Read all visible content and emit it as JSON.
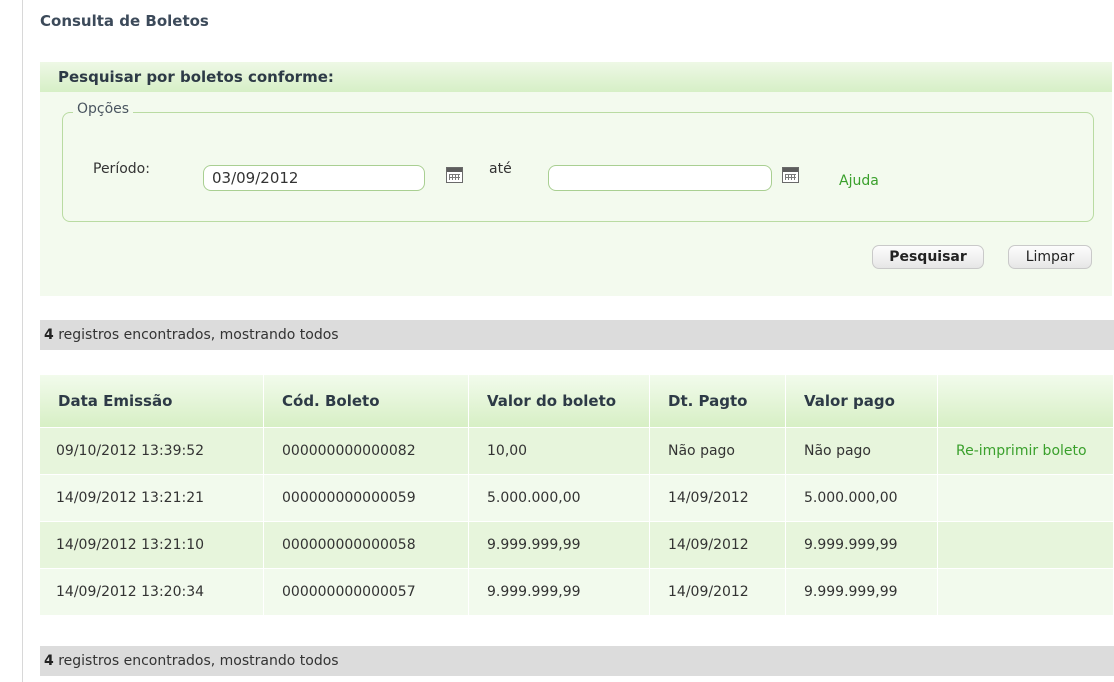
{
  "page": {
    "title": "Consulta de Boletos"
  },
  "search": {
    "header": "Pesquisar por boletos conforme:",
    "options_legend": "Opções",
    "periodo_label": "Período:",
    "date_from": "03/09/2012",
    "ate_label": "até",
    "date_to": "",
    "help_label": "Ajuda",
    "search_button": "Pesquisar",
    "clear_button": "Limpar"
  },
  "results": {
    "count": "4",
    "count_text": " registros encontrados, mostrando todos",
    "columns": [
      "Data Emissão",
      "Cód. Boleto",
      "Valor do boleto",
      "Dt. Pagto",
      "Valor pago",
      ""
    ],
    "rows": [
      {
        "data_emissao": "09/10/2012 13:39:52",
        "cod_boleto": "000000000000082",
        "valor_boleto": "10,00",
        "dt_pagto": "Não pago",
        "valor_pago": "Não pago",
        "action": "Re-imprimir boleto"
      },
      {
        "data_emissao": "14/09/2012 13:21:21",
        "cod_boleto": "000000000000059",
        "valor_boleto": "5.000.000,00",
        "dt_pagto": "14/09/2012",
        "valor_pago": "5.000.000,00",
        "action": ""
      },
      {
        "data_emissao": "14/09/2012 13:21:10",
        "cod_boleto": "000000000000058",
        "valor_boleto": "9.999.999,99",
        "dt_pagto": "14/09/2012",
        "valor_pago": "9.999.999,99",
        "action": ""
      },
      {
        "data_emissao": "14/09/2012 13:20:34",
        "cod_boleto": "000000000000057",
        "valor_boleto": "9.999.999,99",
        "dt_pagto": "14/09/2012",
        "valor_pago": "9.999.999,99",
        "action": ""
      }
    ]
  },
  "colors": {
    "accent_green": "#3aa02c",
    "panel_bg": "#f3faee",
    "header_green": "#d6efc6",
    "count_bar": "#dcdcdc"
  },
  "icons": {
    "date_picker": "calendar-icon"
  }
}
